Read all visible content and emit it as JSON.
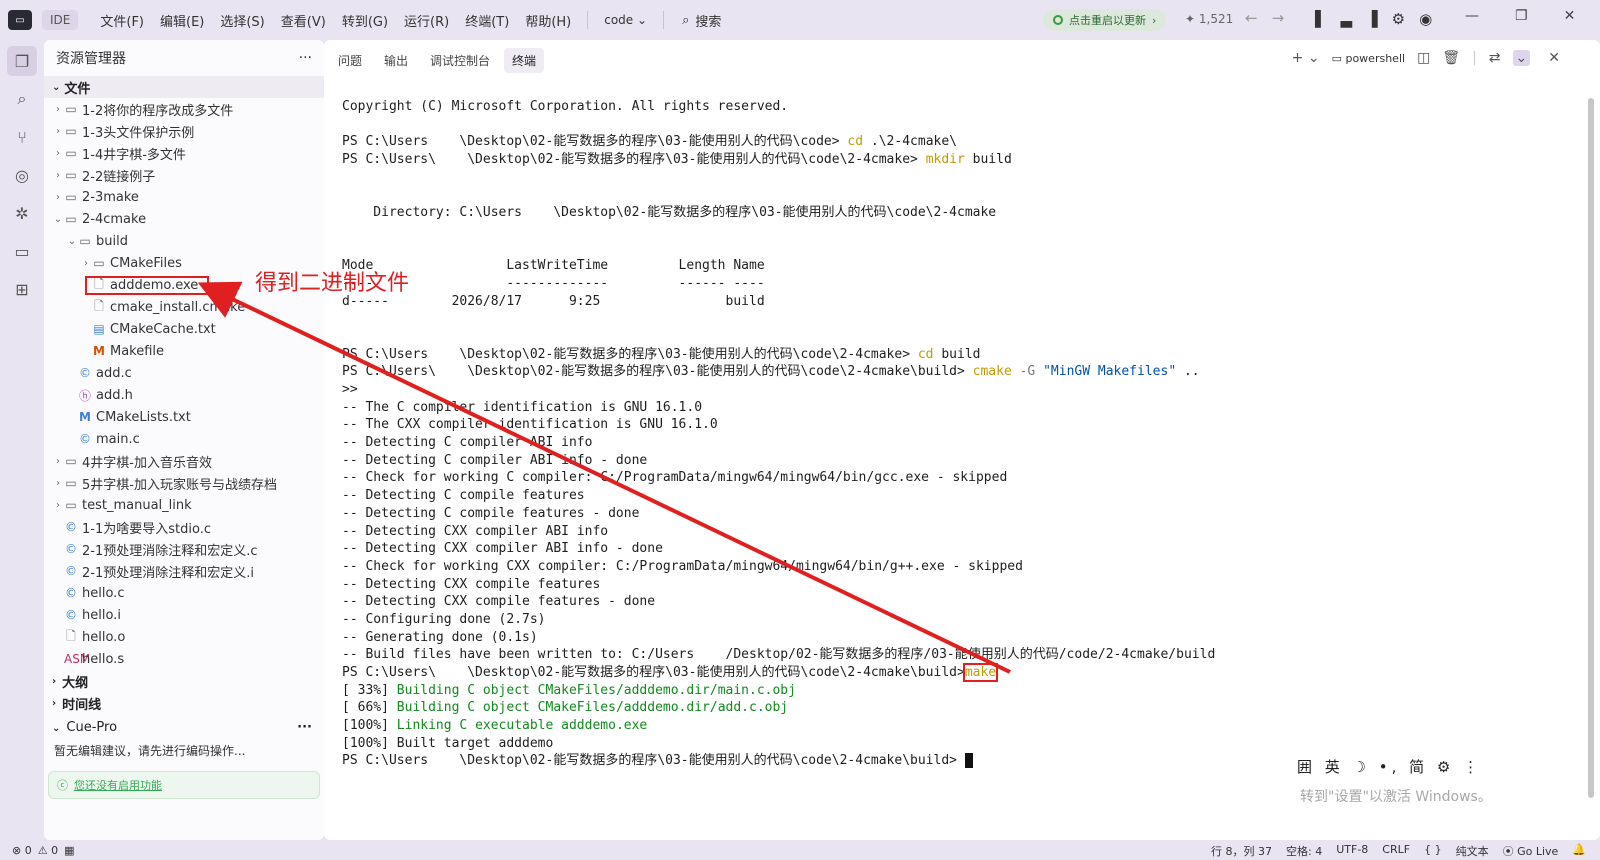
{
  "titlebar": {
    "logo": "▭",
    "app": "IDE",
    "menu": [
      "文件(F)",
      "编辑(E)",
      "选择(S)",
      "查看(V)",
      "转到(G)",
      "运行(R)",
      "终端(T)",
      "帮助(H)"
    ],
    "workspace": "code",
    "search": "搜索",
    "update": "点击重启以更新",
    "stat": "1,521"
  },
  "explorer": {
    "title": "资源管理器",
    "section": "文件",
    "items": [
      {
        "label": "1-2将你的程序改成多文件",
        "depth": 0,
        "kind": "folder",
        "chev": "›"
      },
      {
        "label": "1-3头文件保护示例",
        "depth": 0,
        "kind": "folder",
        "chev": "›"
      },
      {
        "label": "1-4井字棋-多文件",
        "depth": 0,
        "kind": "folder",
        "chev": "›"
      },
      {
        "label": "2-2链接例子",
        "depth": 0,
        "kind": "folder",
        "chev": "›"
      },
      {
        "label": "2-3make",
        "depth": 0,
        "kind": "folder",
        "chev": "›"
      },
      {
        "label": "2-4cmake",
        "depth": 0,
        "kind": "folder",
        "chev": "⌄"
      },
      {
        "label": "build",
        "depth": 1,
        "kind": "folder",
        "chev": "⌄"
      },
      {
        "label": "CMakeFiles",
        "depth": 2,
        "kind": "folder",
        "chev": "›"
      },
      {
        "label": "adddemo.exe",
        "depth": 2,
        "kind": "file",
        "chev": "",
        "highlight": true
      },
      {
        "label": "cmake_install.cmake",
        "depth": 2,
        "kind": "file",
        "chev": ""
      },
      {
        "label": "CMakeCache.txt",
        "depth": 2,
        "kind": "txt",
        "chev": ""
      },
      {
        "label": "Makefile",
        "depth": 2,
        "kind": "m",
        "chev": ""
      },
      {
        "label": "add.c",
        "depth": 1,
        "kind": "c",
        "chev": ""
      },
      {
        "label": "add.h",
        "depth": 1,
        "kind": "h",
        "chev": ""
      },
      {
        "label": "CMakeLists.txt",
        "depth": 1,
        "kind": "cm",
        "chev": ""
      },
      {
        "label": "main.c",
        "depth": 1,
        "kind": "c",
        "chev": ""
      },
      {
        "label": "4井字棋-加入音乐音效",
        "depth": 0,
        "kind": "folder",
        "chev": "›"
      },
      {
        "label": "5井字棋-加入玩家账号与战绩存档",
        "depth": 0,
        "kind": "folder",
        "chev": "›"
      },
      {
        "label": "test_manual_link",
        "depth": 0,
        "kind": "folder",
        "chev": "›"
      },
      {
        "label": "1-1为啥要导入stdio.c",
        "depth": 0,
        "kind": "c",
        "chev": ""
      },
      {
        "label": "2-1预处理消除注释和宏定义.c",
        "depth": 0,
        "kind": "c",
        "chev": ""
      },
      {
        "label": "2-1预处理消除注释和宏定义.i",
        "depth": 0,
        "kind": "c",
        "chev": ""
      },
      {
        "label": "hello.c",
        "depth": 0,
        "kind": "c",
        "chev": ""
      },
      {
        "label": "hello.i",
        "depth": 0,
        "kind": "c",
        "chev": ""
      },
      {
        "label": "hello.o",
        "depth": 0,
        "kind": "file",
        "chev": ""
      },
      {
        "label": "hello.s",
        "depth": 0,
        "kind": "asm",
        "chev": ""
      }
    ],
    "outline": "大纲",
    "timeline": "时间线",
    "cue_title": "Cue-Pro",
    "cue_text": "暂无编辑建议，请先进行编码操作...",
    "cue_card": "您还没有启用功能"
  },
  "panel": {
    "tabs": [
      "问题",
      "输出",
      "调试控制台",
      "终端"
    ],
    "active_tab": 3,
    "shell": "powershell"
  },
  "terminal": {
    "lines": [
      [
        {
          "t": "Copyright (C) Microsoft Corporation. All rights reserved."
        }
      ],
      [
        {
          "t": ""
        }
      ],
      [
        {
          "t": "PS C:\\Users    \\Desktop\\02-能写数据多的程序\\03-能使用别人的代码\\code> "
        },
        {
          "t": "cd",
          "c": "kw"
        },
        {
          "t": " .\\2-4cmake\\"
        }
      ],
      [
        {
          "t": "PS C:\\Users\\    \\Desktop\\02-能写数据多的程序\\03-能使用别人的代码\\code\\2-4cmake> "
        },
        {
          "t": "mkdir",
          "c": "kw"
        },
        {
          "t": " build"
        }
      ],
      [
        {
          "t": ""
        }
      ],
      [
        {
          "t": ""
        }
      ],
      [
        {
          "t": "    Directory: C:\\Users    \\Desktop\\02-能写数据多的程序\\03-能使用别人的代码\\code\\2-4cmake"
        }
      ],
      [
        {
          "t": ""
        }
      ],
      [
        {
          "t": ""
        }
      ],
      [
        {
          "t": "Mode                 LastWriteTime         Length Name"
        }
      ],
      [
        {
          "t": "----                 -------------         ------ ----"
        }
      ],
      [
        {
          "t": "d-----        2026/8/17      9:25                build"
        }
      ],
      [
        {
          "t": ""
        }
      ],
      [
        {
          "t": ""
        }
      ],
      [
        {
          "t": "PS C:\\Users    \\Desktop\\02-能写数据多的程序\\03-能使用别人的代码\\code\\2-4cmake> "
        },
        {
          "t": "cd",
          "c": "kw"
        },
        {
          "t": " build"
        }
      ],
      [
        {
          "t": "PS C:\\Users\\    \\Desktop\\02-能写数据多的程序\\03-能使用别人的代码\\code\\2-4cmake\\build> "
        },
        {
          "t": "cmake",
          "c": "kw"
        },
        {
          "t": " -G ",
          "c": "flag"
        },
        {
          "t": "\"MinGW Makefiles\"",
          "c": "str"
        },
        {
          "t": " .."
        }
      ],
      [
        {
          "t": ">>"
        }
      ],
      [
        {
          "t": "-- The C compiler identification is GNU 16.1.0"
        }
      ],
      [
        {
          "t": "-- The CXX compiler identification is GNU 16.1.0"
        }
      ],
      [
        {
          "t": "-- Detecting C compiler ABI info"
        }
      ],
      [
        {
          "t": "-- Detecting C compiler ABI info - done"
        }
      ],
      [
        {
          "t": "-- Check for working C compiler: C:/ProgramData/mingw64/mingw64/bin/gcc.exe - skipped"
        }
      ],
      [
        {
          "t": "-- Detecting C compile features"
        }
      ],
      [
        {
          "t": "-- Detecting C compile features - done"
        }
      ],
      [
        {
          "t": "-- Detecting CXX compiler ABI info"
        }
      ],
      [
        {
          "t": "-- Detecting CXX compiler ABI info - done"
        }
      ],
      [
        {
          "t": "-- Check for working CXX compiler: C:/ProgramData/mingw64/mingw64/bin/g++.exe - skipped"
        }
      ],
      [
        {
          "t": "-- Detecting CXX compile features"
        }
      ],
      [
        {
          "t": "-- Detecting CXX compile features - done"
        }
      ],
      [
        {
          "t": "-- Configuring done (2.7s)"
        }
      ],
      [
        {
          "t": "-- Generating done (0.1s)"
        }
      ],
      [
        {
          "t": "-- Build files have been written to: C:/Users    /Desktop/02-能写数据多的程序/03-能使用别人的代码/code/2-4cmake/build"
        }
      ],
      [
        {
          "t": "PS C:\\Users\\    \\Desktop\\02-能写数据多的程序\\03-能使用别人的代码\\code\\2-4cmake\\build>"
        },
        {
          "t": "make",
          "c": "kw mk"
        }
      ],
      [
        {
          "t": "[ 33%] "
        },
        {
          "t": "Building C object CMakeFiles/adddemo.dir/main.c.obj",
          "c": "grn"
        }
      ],
      [
        {
          "t": "[ 66%] "
        },
        {
          "t": "Building C object CMakeFiles/adddemo.dir/add.c.obj",
          "c": "grn"
        }
      ],
      [
        {
          "t": "[100%] "
        },
        {
          "t": "Linking C executable adddemo.exe",
          "c": "grn"
        }
      ],
      [
        {
          "t": "[100%] Built target adddemo"
        }
      ],
      [
        {
          "t": "PS C:\\Users    \\Desktop\\02-能写数据多的程序\\03-能使用别人的代码\\code\\2-4cmake\\build> "
        },
        {
          "t": "",
          "c": "cursor"
        }
      ]
    ]
  },
  "annotation": "得到二进制文件",
  "ime": "囲 英 ☽ •, 简 ⚙ ⋮",
  "watermark": "转到\"设置\"以激活 Windows。",
  "statusbar": {
    "errors": "⊗ 0",
    "warnings": "⚠ 0",
    "position": "行 8，列 37",
    "spaces": "空格: 4",
    "encoding": "UTF-8",
    "eol": "CRLF",
    "braces": "{ }",
    "lang": "纯文本",
    "golive": "Go Live",
    "bell": "🔔"
  },
  "colors": {
    "accent": "#e02020",
    "chrome": "#e9e4f1",
    "term_green": "#12891d"
  }
}
